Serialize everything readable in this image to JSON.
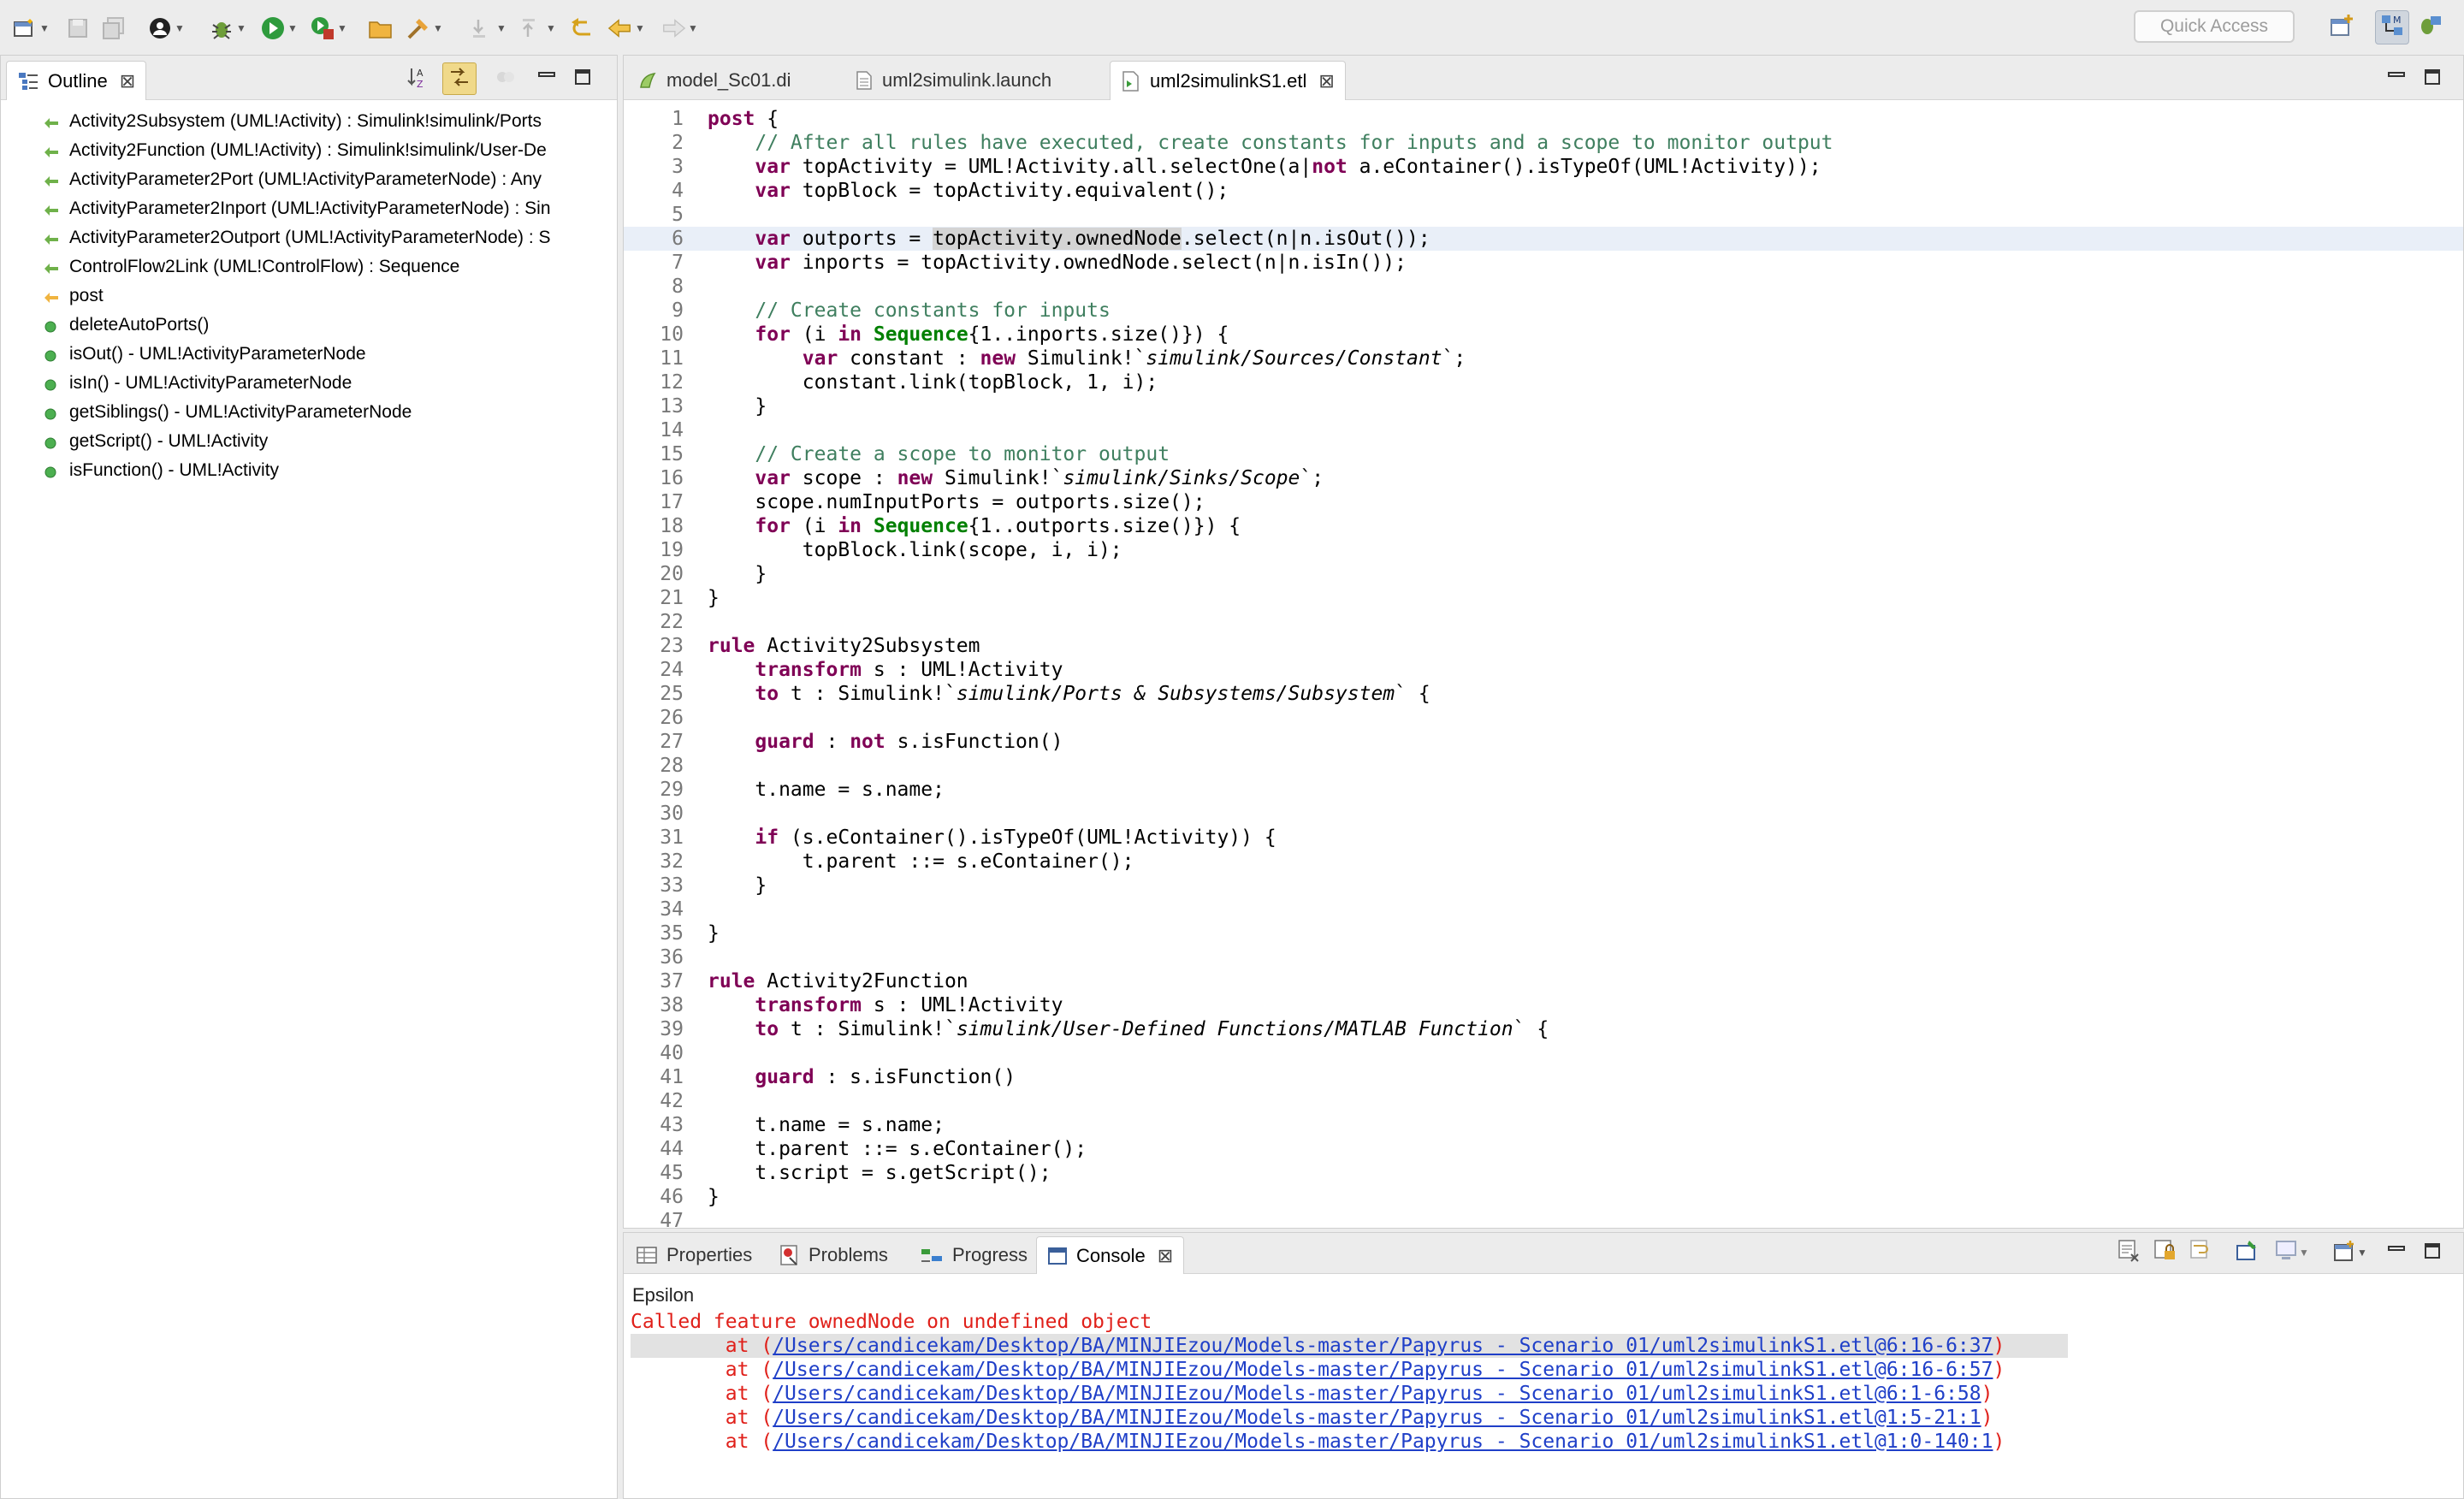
{
  "toolbar": {
    "quick_access_placeholder": "Quick Access",
    "icons": [
      "new-wizard-icon",
      "save-icon",
      "save-all-icon",
      "user-icon",
      "debug-icon",
      "run-icon",
      "external-tools-icon",
      "open-folder-icon",
      "build-icon",
      "next-annotation-icon",
      "prev-annotation-icon",
      "last-edit-icon",
      "back-icon",
      "forward-icon"
    ]
  },
  "outline": {
    "title": "Outline",
    "items": [
      {
        "label": "Activity2Subsystem (UML!Activity) : Simulink!simulink/Ports",
        "kind": "rule"
      },
      {
        "label": "Activity2Function (UML!Activity) : Simulink!simulink/User-De",
        "kind": "rule"
      },
      {
        "label": "ActivityParameter2Port (UML!ActivityParameterNode) : Any",
        "kind": "rule"
      },
      {
        "label": "ActivityParameter2Inport (UML!ActivityParameterNode) : Sin",
        "kind": "rule"
      },
      {
        "label": "ActivityParameter2Outport (UML!ActivityParameterNode) : S",
        "kind": "rule"
      },
      {
        "label": "ControlFlow2Link (UML!ControlFlow) : Sequence",
        "kind": "rule"
      },
      {
        "label": "post",
        "kind": "post"
      },
      {
        "label": "deleteAutoPorts()",
        "kind": "op"
      },
      {
        "label": "isOut() - UML!ActivityParameterNode",
        "kind": "op"
      },
      {
        "label": "isIn() - UML!ActivityParameterNode",
        "kind": "op"
      },
      {
        "label": "getSiblings() - UML!ActivityParameterNode",
        "kind": "op"
      },
      {
        "label": "getScript() - UML!Activity",
        "kind": "op"
      },
      {
        "label": "isFunction() - UML!Activity",
        "kind": "op"
      }
    ]
  },
  "editor": {
    "tabs": [
      {
        "label": "model_Sc01.di"
      },
      {
        "label": "uml2simulink.launch"
      },
      {
        "label": "uml2simulinkS1.etl"
      }
    ],
    "line_numbers": [
      "1",
      "2",
      "3",
      "4",
      "5",
      "6",
      "7",
      "8",
      "9",
      "10",
      "11",
      "12",
      "13",
      "14",
      "15",
      "16",
      "17",
      "18",
      "19",
      "20",
      "21",
      "22",
      "23",
      "24",
      "25",
      "26",
      "27",
      "28",
      "29",
      "30",
      "31",
      "32",
      "33",
      "34",
      "35",
      "36",
      "37",
      "38",
      "39",
      "40",
      "41",
      "42",
      "43",
      "44",
      "45",
      "46",
      "47"
    ],
    "t": {
      "post": "post",
      "brace_open": " {",
      "l2": "// After all rules have executed, create constants for inputs and a scope to monitor output",
      "var": "var",
      "l3a": " topActivity = UML!Activity.all.selectOne(a|",
      "not": "not",
      "l3b": " a.eContainer().isTypeOf(UML!Activity));",
      "l4": " topBlock = topActivity.equivalent();",
      "l6a": " outports = ",
      "l6occ": "topActivity.ownedNode",
      "l6b": ".select(n|n.isOut());",
      "l7": " inports = topActivity.ownedNode.select(n|n.isIn());",
      "l9": "// Create constants for inputs",
      "for": "for",
      "in": "in",
      "sequence": "Sequence",
      "l10a": " (i ",
      "l10b": "{1..inports.size()}) {",
      "l11a": " constant : ",
      "new": "new",
      "l11b": " Simulink!`",
      "l11c": "simulink/Sources/Constant",
      "l11d": "`;",
      "l12": "constant.link(topBlock, 1, i);",
      "close": "}",
      "l15": "// Create a scope to monitor output",
      "l16a": " scope : ",
      "l16c": "simulink/Sinks/Scope",
      "l17": "scope.numInputPorts = outports.size();",
      "l18b": "{1..outports.size()}) {",
      "l19": "topBlock.link(scope, i, i);",
      "rule": "rule",
      "l23": " Activity2Subsystem",
      "transform": "transform",
      "l24": " s : UML!Activity",
      "to": "to",
      "l25a": " t : Simulink!`",
      "l25c": "simulink/Ports & Subsystems/Subsystem",
      "l25d": "` {",
      "guard": "guard",
      "l27a": " : ",
      "l27b": " s.isFunction()",
      "l29": "t.name = s.name;",
      "if": "if",
      "l31": " (s.eContainer().isTypeOf(UML!Activity)) {",
      "l32": "t.parent ::= s.eContainer();",
      "l37": " Activity2Function",
      "l39c": "simulink/User-Defined Functions/MATLAB Function",
      "l41": " : s.isFunction()",
      "l44": "t.parent ::= s.eContainer();",
      "l45": "t.script = s.getScript();"
    }
  },
  "bottom": {
    "tabs": [
      {
        "label": "Properties"
      },
      {
        "label": "Problems"
      },
      {
        "label": "Progress"
      },
      {
        "label": "Console"
      }
    ],
    "console": {
      "name": "Epsilon",
      "error": "Called feature ownedNode on undefined object",
      "at": "at",
      "open": "(",
      "close": ")",
      "links": [
        "/Users/candicekam/Desktop/BA/MINJIEzou/Models-master/Papyrus - Scenario 01/uml2simulinkS1.etl@6:16-6:37",
        "/Users/candicekam/Desktop/BA/MINJIEzou/Models-master/Papyrus - Scenario 01/uml2simulinkS1.etl@6:16-6:57",
        "/Users/candicekam/Desktop/BA/MINJIEzou/Models-master/Papyrus - Scenario 01/uml2simulinkS1.etl@6:1-6:58",
        "/Users/candicekam/Desktop/BA/MINJIEzou/Models-master/Papyrus - Scenario 01/uml2simulinkS1.etl@1:5-21:1",
        "/Users/candicekam/Desktop/BA/MINJIEzou/Models-master/Papyrus - Scenario 01/uml2simulinkS1.etl@1:0-140:1"
      ]
    }
  }
}
